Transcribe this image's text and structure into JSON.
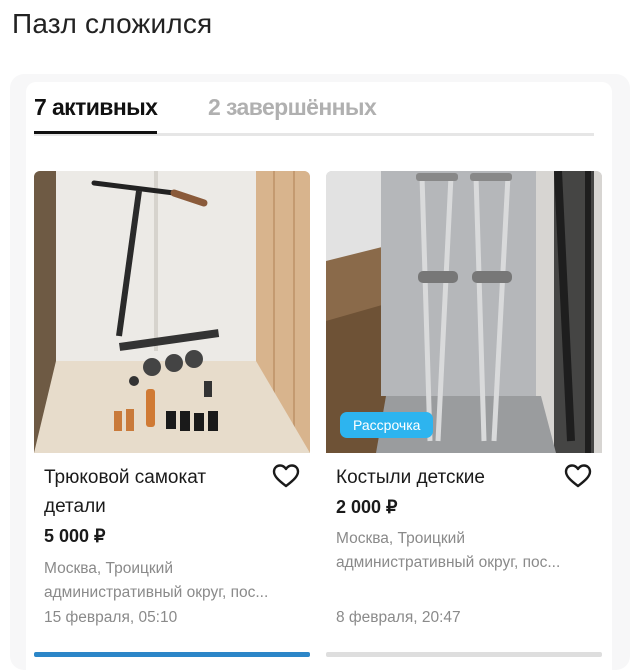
{
  "post": {
    "title": "Пазл сложился"
  },
  "tabs": [
    {
      "label": "7 активных",
      "active": true
    },
    {
      "label": "2 завершённых",
      "active": false
    }
  ],
  "listings": [
    {
      "title": "Трюковой самокат детали",
      "price": "5 000 ₽",
      "location": "Москва, Троицкий административный округ, пос...",
      "date": "15 февраля, 05:10",
      "badge": "",
      "photo_icon": "scooter-parts-photo"
    },
    {
      "title": "Костыли детские",
      "price": "2 000 ₽",
      "location": "Москва, Троицкий административный округ, пос...",
      "date": "8 февраля, 20:47",
      "badge": "Рассрочка",
      "photo_icon": "crutches-photo"
    }
  ],
  "colors": {
    "badge": "#2db4ef",
    "accent": "#2c86c8",
    "muted_text": "#8a8a8a"
  },
  "icons": {
    "favorite": "heart-outline-icon"
  }
}
